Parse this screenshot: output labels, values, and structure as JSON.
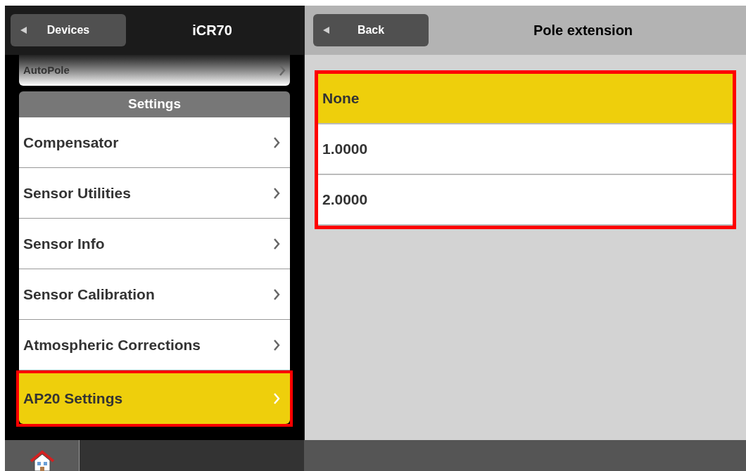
{
  "left_panel": {
    "back_button": "Devices",
    "title": "iCR70",
    "partial_item": "AutoPole",
    "section": "Settings",
    "items": [
      {
        "label": "Compensator",
        "selected": false
      },
      {
        "label": "Sensor Utilities",
        "selected": false
      },
      {
        "label": "Sensor Info",
        "selected": false
      },
      {
        "label": "Sensor Calibration",
        "selected": false
      },
      {
        "label": "Atmospheric Corrections",
        "selected": false
      },
      {
        "label": "AP20 Settings",
        "selected": true,
        "highlighted": true
      }
    ]
  },
  "right_panel": {
    "back_button": "Back",
    "title": "Pole extension",
    "highlighted": true,
    "options": [
      {
        "label": "None",
        "selected": true
      },
      {
        "label": "1.0000",
        "selected": false
      },
      {
        "label": "2.0000",
        "selected": false
      }
    ]
  }
}
